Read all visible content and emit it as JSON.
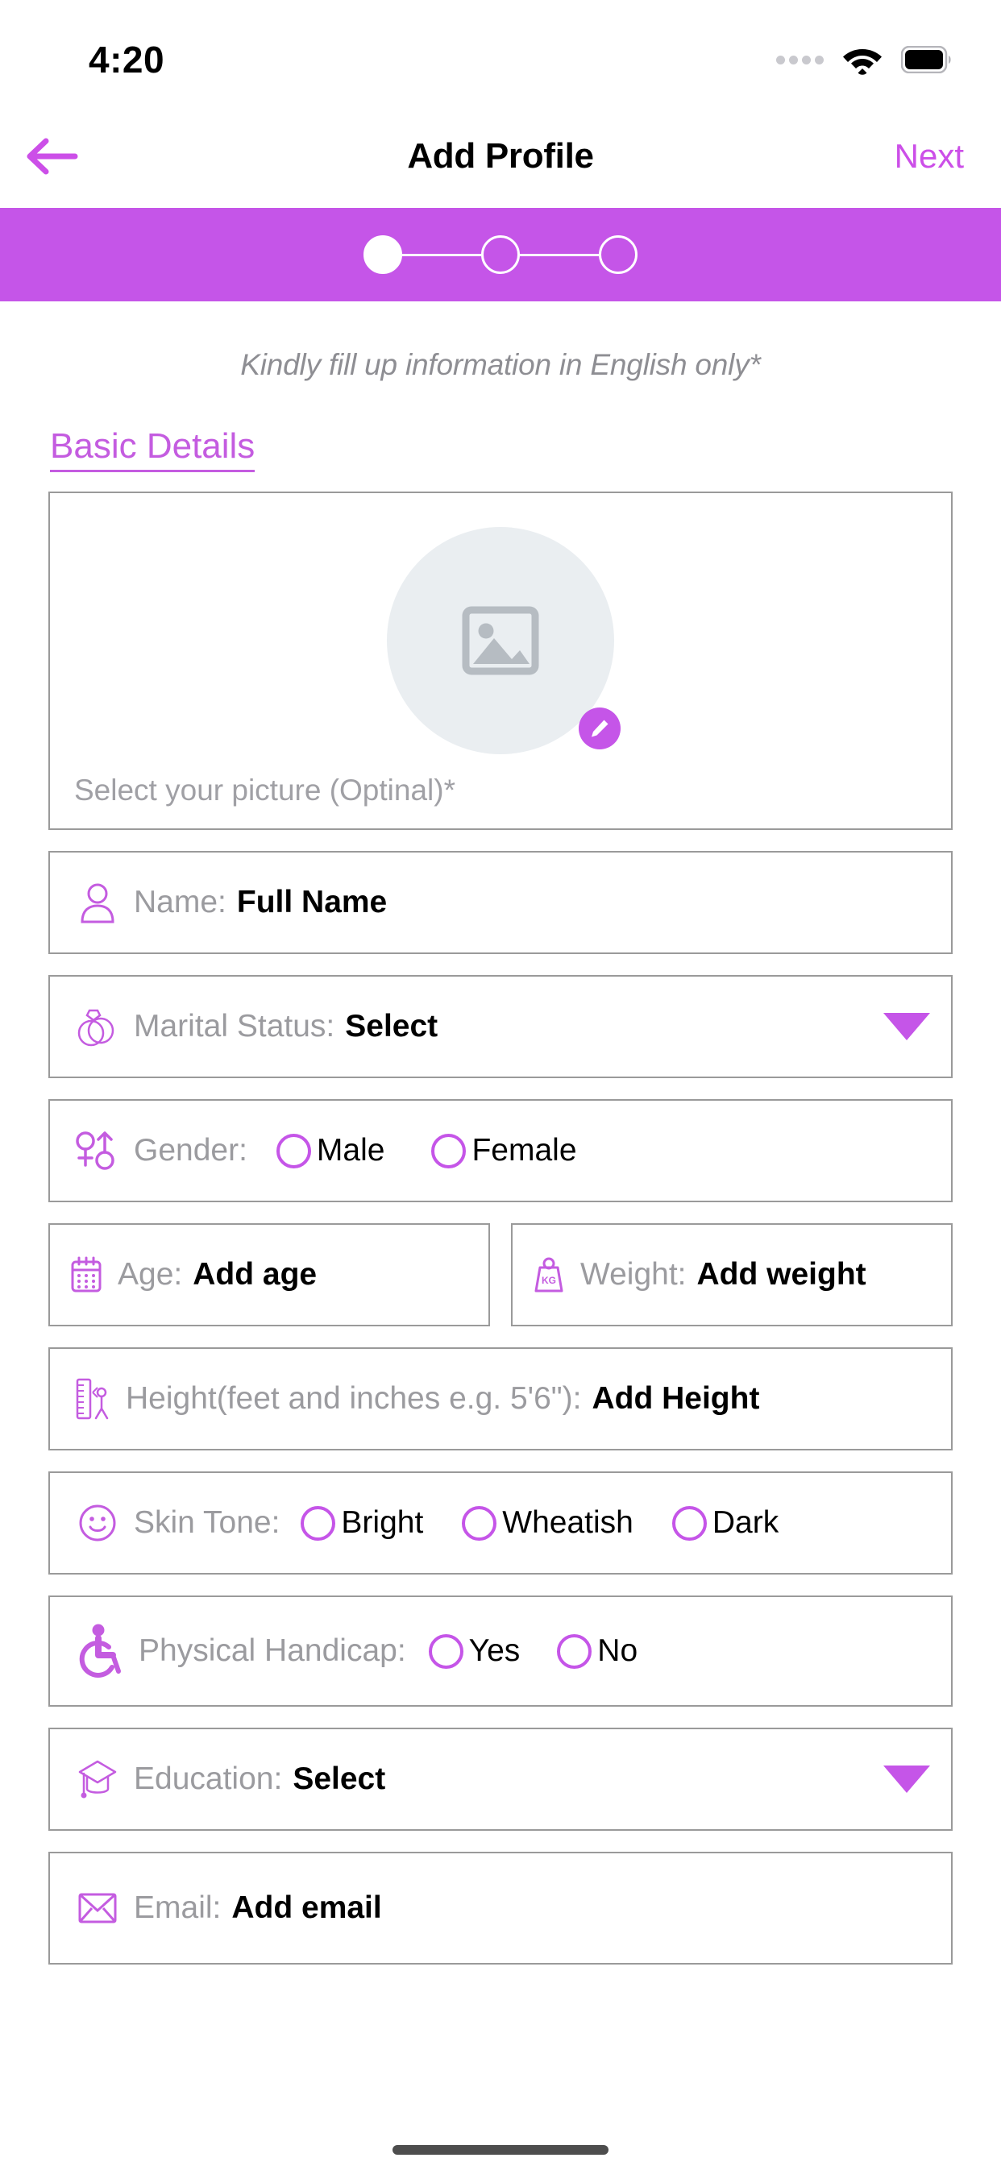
{
  "status_bar": {
    "time": "4:20",
    "signal_icon": "signal-dots-icon",
    "wifi_icon": "wifi-icon",
    "battery_icon": "battery-full-icon"
  },
  "nav": {
    "back_icon": "arrow-left-icon",
    "title": "Add Profile",
    "next_label": "Next"
  },
  "stepper": {
    "total_steps": 3,
    "current_step": 1,
    "steps": [
      {
        "index": "1",
        "state": "active"
      },
      {
        "index": "2",
        "state": "pending"
      },
      {
        "index": "3",
        "state": "pending"
      }
    ]
  },
  "colors": {
    "accent_purple": "#c555e8",
    "heading_purple": "#c45ce0",
    "next_purple": "#cc4fe8",
    "label_gray": "#9b9b9f",
    "hint_gray": "#8e8e93",
    "border_gray": "#9a9a9a",
    "avatar_bg": "#eaeef1"
  },
  "form": {
    "hint": "Kindly fill up information in English only*",
    "section_title": "Basic Details",
    "photo": {
      "icon": "image-placeholder-icon",
      "edit_icon": "pencil-icon",
      "caption": "Select your picture (Optinal)*"
    },
    "fields": [
      {
        "key": "name",
        "icon": "person-icon",
        "label": "Name:",
        "value": "Full Name",
        "type": "text"
      },
      {
        "key": "marital_status",
        "icon": "wedding-rings-icon",
        "label": "Marital Status:",
        "value": "Select",
        "type": "dropdown",
        "caret_icon": "caret-down-icon"
      },
      {
        "key": "gender",
        "icon": "gender-icon",
        "label": "Gender:",
        "type": "radio",
        "options": [
          "Male",
          "Female"
        ]
      },
      {
        "key": "age",
        "icon": "calendar-icon",
        "label": "Age:",
        "value": "Add age",
        "type": "text"
      },
      {
        "key": "weight",
        "icon": "weight-kg-icon",
        "label": "Weight:",
        "value": "Add weight",
        "type": "text"
      },
      {
        "key": "height",
        "icon": "height-ruler-icon",
        "label": "Height(feet and inches e.g. 5'6\"):",
        "value": "Add Height",
        "type": "text"
      },
      {
        "key": "skin_tone",
        "icon": "smiley-face-icon",
        "label": "Skin Tone:",
        "type": "radio",
        "options": [
          "Bright",
          "Wheatish",
          "Dark"
        ]
      },
      {
        "key": "physical_handicap",
        "icon": "wheelchair-icon",
        "label": "Physical Handicap:",
        "type": "radio",
        "options": [
          "Yes",
          "No"
        ]
      },
      {
        "key": "education",
        "icon": "graduation-cap-icon",
        "label": "Education:",
        "value": "Select",
        "type": "dropdown",
        "caret_icon": "caret-down-icon"
      },
      {
        "key": "email",
        "icon": "envelope-icon",
        "label": "Email:",
        "value": "Add email",
        "type": "text"
      }
    ]
  }
}
